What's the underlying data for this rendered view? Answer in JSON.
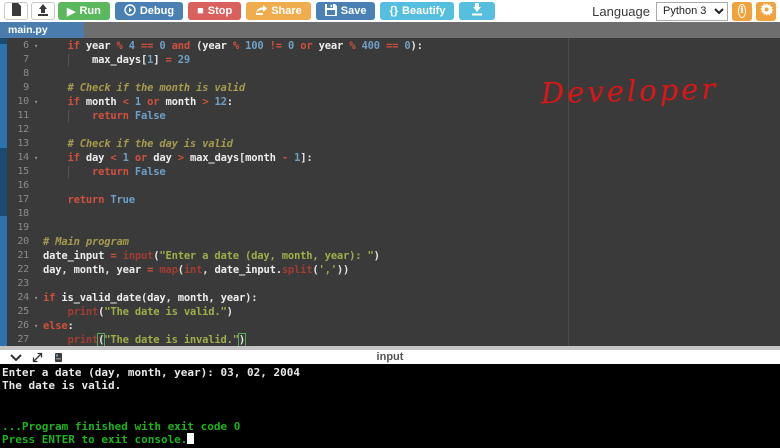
{
  "header": {
    "buttons": {
      "run": "Run",
      "debug": "Debug",
      "stop": "Stop",
      "share": "Share",
      "save": "Save",
      "beautify": "Beautify",
      "beautify_icon": "{}"
    },
    "language_label": "Language",
    "language_value": "Python 3"
  },
  "tab": {
    "name": "main.py"
  },
  "editor": {
    "annotation": "Developer",
    "lines": [
      {
        "num": 6,
        "fold": true,
        "tok": [
          [
            "t",
            "    "
          ],
          [
            "k",
            "if "
          ],
          [
            "i",
            "year "
          ],
          [
            "k",
            "% "
          ],
          [
            "n",
            "4 "
          ],
          [
            "k",
            "== "
          ],
          [
            "n",
            "0 "
          ],
          [
            "k",
            "and "
          ],
          [
            "p",
            "("
          ],
          [
            "i",
            "year "
          ],
          [
            "k",
            "% "
          ],
          [
            "n",
            "100 "
          ],
          [
            "k",
            "!= "
          ],
          [
            "n",
            "0 "
          ],
          [
            "k",
            "or "
          ],
          [
            "i",
            "year "
          ],
          [
            "k",
            "% "
          ],
          [
            "n",
            "400 "
          ],
          [
            "k",
            "== "
          ],
          [
            "n",
            "0"
          ],
          [
            "p",
            "):"
          ]
        ]
      },
      {
        "num": 7,
        "guide": true,
        "tok": [
          [
            "t",
            "        "
          ],
          [
            "i",
            "max_days"
          ],
          [
            "p",
            "["
          ],
          [
            "n",
            "1"
          ],
          [
            "p",
            "] "
          ],
          [
            "k",
            "= "
          ],
          [
            "n",
            "29"
          ]
        ]
      },
      {
        "num": 8,
        "tok": []
      },
      {
        "num": 9,
        "tok": [
          [
            "t",
            "    "
          ],
          [
            "c",
            "# Check if the month is valid"
          ]
        ]
      },
      {
        "num": 10,
        "fold": true,
        "tok": [
          [
            "t",
            "    "
          ],
          [
            "k",
            "if "
          ],
          [
            "i",
            "month "
          ],
          [
            "k",
            "< "
          ],
          [
            "n",
            "1 "
          ],
          [
            "k",
            "or "
          ],
          [
            "i",
            "month "
          ],
          [
            "k",
            "> "
          ],
          [
            "n",
            "12"
          ],
          [
            "p",
            ":"
          ]
        ]
      },
      {
        "num": 11,
        "guide": true,
        "tok": [
          [
            "t",
            "        "
          ],
          [
            "k",
            "return "
          ],
          [
            "n",
            "False"
          ]
        ]
      },
      {
        "num": 12,
        "tok": []
      },
      {
        "num": 13,
        "tok": [
          [
            "t",
            "    "
          ],
          [
            "c",
            "# Check if the day is valid"
          ]
        ]
      },
      {
        "num": 14,
        "fold": true,
        "tok": [
          [
            "t",
            "    "
          ],
          [
            "k",
            "if "
          ],
          [
            "i",
            "day "
          ],
          [
            "k",
            "< "
          ],
          [
            "n",
            "1 "
          ],
          [
            "k",
            "or "
          ],
          [
            "i",
            "day "
          ],
          [
            "k",
            "> "
          ],
          [
            "i",
            "max_days"
          ],
          [
            "p",
            "["
          ],
          [
            "i",
            "month "
          ],
          [
            "k",
            "- "
          ],
          [
            "n",
            "1"
          ],
          [
            "p",
            "]:"
          ]
        ]
      },
      {
        "num": 15,
        "guide": true,
        "tok": [
          [
            "t",
            "        "
          ],
          [
            "k",
            "return "
          ],
          [
            "n",
            "False"
          ]
        ]
      },
      {
        "num": 16,
        "tok": []
      },
      {
        "num": 17,
        "tok": [
          [
            "t",
            "    "
          ],
          [
            "k",
            "return "
          ],
          [
            "n",
            "True"
          ]
        ]
      },
      {
        "num": 18,
        "tok": []
      },
      {
        "num": 19,
        "tok": []
      },
      {
        "num": 20,
        "tok": [
          [
            "c",
            "# Main program"
          ]
        ]
      },
      {
        "num": 21,
        "tok": [
          [
            "i",
            "date_input "
          ],
          [
            "k",
            "= "
          ],
          [
            "b",
            "input"
          ],
          [
            "p",
            "("
          ],
          [
            "s",
            "\"Enter a date (day, month, year): \""
          ],
          [
            "p",
            ")"
          ]
        ]
      },
      {
        "num": 22,
        "tok": [
          [
            "i",
            "day"
          ],
          [
            "p",
            ", "
          ],
          [
            "i",
            "month"
          ],
          [
            "p",
            ", "
          ],
          [
            "i",
            "year "
          ],
          [
            "k",
            "= "
          ],
          [
            "b",
            "map"
          ],
          [
            "p",
            "("
          ],
          [
            "b",
            "int"
          ],
          [
            "p",
            ", "
          ],
          [
            "i",
            "date_input"
          ],
          [
            "p",
            "."
          ],
          [
            "b",
            "split"
          ],
          [
            "p",
            "("
          ],
          [
            "s",
            "','"
          ],
          [
            "p",
            "))"
          ]
        ]
      },
      {
        "num": 23,
        "tok": []
      },
      {
        "num": 24,
        "fold": true,
        "tok": [
          [
            "k",
            "if "
          ],
          [
            "i",
            "is_valid_date"
          ],
          [
            "p",
            "("
          ],
          [
            "i",
            "day"
          ],
          [
            "p",
            ", "
          ],
          [
            "i",
            "month"
          ],
          [
            "p",
            ", "
          ],
          [
            "i",
            "year"
          ],
          [
            "p",
            "):"
          ]
        ]
      },
      {
        "num": 25,
        "tok": [
          [
            "t",
            "    "
          ],
          [
            "b",
            "print"
          ],
          [
            "p",
            "("
          ],
          [
            "s",
            "\"The date is valid.\""
          ],
          [
            "p",
            ")"
          ]
        ]
      },
      {
        "num": 26,
        "fold": true,
        "tok": [
          [
            "k",
            "else"
          ],
          [
            "p",
            ":"
          ]
        ]
      },
      {
        "num": 27,
        "tok": [
          [
            "t",
            "    "
          ],
          [
            "b",
            "print"
          ],
          [
            "g",
            "("
          ],
          [
            "s",
            "\"The date is invalid.\""
          ],
          [
            "g",
            ")"
          ]
        ]
      }
    ]
  },
  "console_bar": {
    "label": "input"
  },
  "console": {
    "lines": [
      {
        "text": "Enter a date (day, month, year): 03, 02, 2004",
        "color": "w"
      },
      {
        "text": "The date is valid.",
        "color": "w"
      },
      {
        "text": "",
        "color": "w"
      },
      {
        "text": "",
        "color": "w"
      },
      {
        "text": "...Program finished with exit code 0",
        "color": "g"
      },
      {
        "text": "Press ENTER to exit console.",
        "color": "g",
        "cursor": true
      }
    ]
  },
  "colors": {
    "run_green": "#5cb85c",
    "debug_save_blue": "#4a81b4",
    "stop_red": "#d9605c",
    "share_orange": "#f0ad4e",
    "beautify_cyan": "#56bfdf",
    "tab_blue": "#4a7cae",
    "console_green": "#1db41d",
    "annotation_red": "#e21414",
    "editor_bg": "#3a3a3a"
  }
}
